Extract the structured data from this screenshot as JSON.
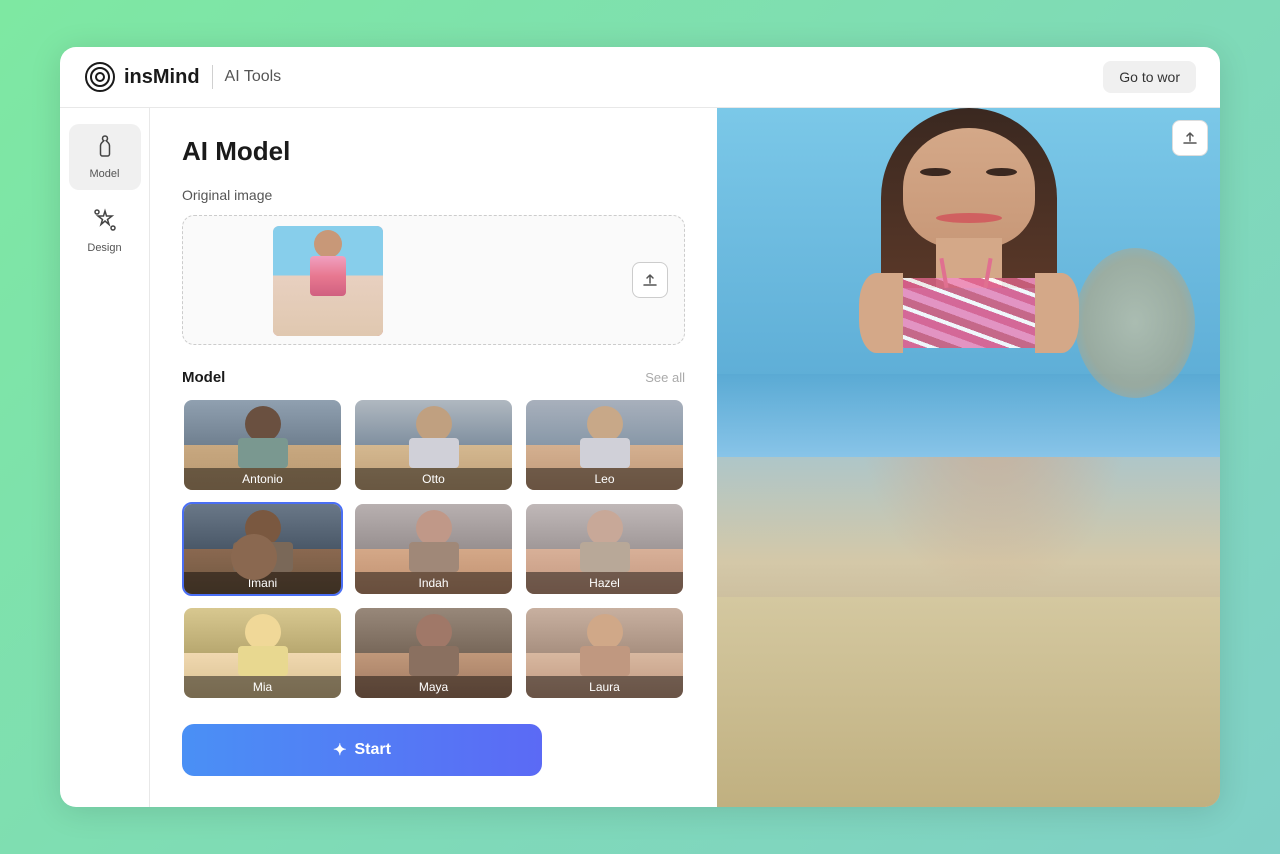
{
  "header": {
    "logo_text": "insMind",
    "nav_label": "AI Tools",
    "go_to_work_label": "Go to wor"
  },
  "sidebar": {
    "items": [
      {
        "id": "model",
        "label": "Model",
        "icon": "👗",
        "active": true
      },
      {
        "id": "design",
        "label": "Design",
        "icon": "✳️",
        "active": false
      }
    ]
  },
  "main": {
    "page_title": "AI Model",
    "original_image_label": "Original image",
    "model_section_label": "Model",
    "see_all_label": "See all",
    "start_button_label": "Start",
    "upload_icon": "↑",
    "spark_icon": "✦"
  },
  "models": [
    {
      "id": "antonio",
      "name": "Antonio",
      "selected": false,
      "skin": "dark"
    },
    {
      "id": "otto",
      "name": "Otto",
      "selected": false,
      "skin": "medium"
    },
    {
      "id": "leo",
      "name": "Leo",
      "selected": false,
      "skin": "medium-light"
    },
    {
      "id": "imani",
      "name": "Imani",
      "selected": true,
      "skin": "dark-brown"
    },
    {
      "id": "indah",
      "name": "Indah",
      "selected": false,
      "skin": "medium"
    },
    {
      "id": "hazel",
      "name": "Hazel",
      "selected": false,
      "skin": "light-medium"
    },
    {
      "id": "mia",
      "name": "Mia",
      "selected": false,
      "skin": "blonde-fair"
    },
    {
      "id": "maya",
      "name": "Maya",
      "selected": false,
      "skin": "olive"
    },
    {
      "id": "laura",
      "name": "Laura",
      "selected": false,
      "skin": "medium-fair"
    }
  ],
  "colors": {
    "accent_blue": "#4a6ff5",
    "start_btn_from": "#4a90f5",
    "start_btn_to": "#5b6af5",
    "selected_border": "#4a6ff5",
    "bg_green": "#7ee8a2"
  }
}
